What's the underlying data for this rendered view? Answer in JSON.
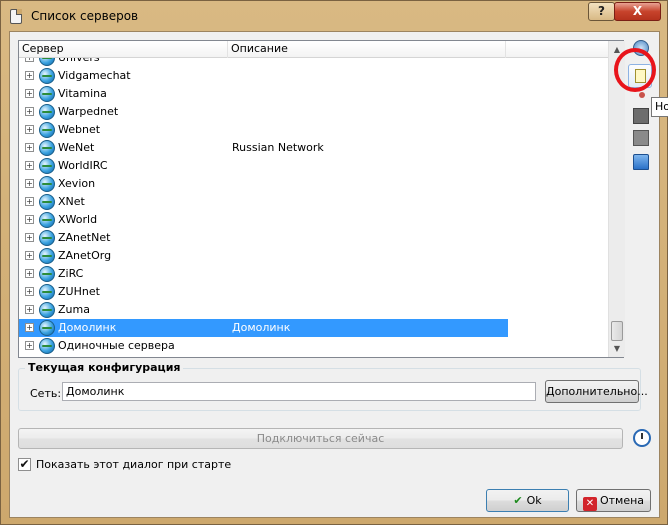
{
  "window": {
    "title": "Список серверов",
    "help_label": "?",
    "close_label": "X"
  },
  "list": {
    "columns": [
      "Сервер",
      "Описание"
    ],
    "rows": [
      {
        "name": "Univers",
        "desc": ""
      },
      {
        "name": "Vidgamechat",
        "desc": ""
      },
      {
        "name": "Vitamina",
        "desc": ""
      },
      {
        "name": "Warpednet",
        "desc": ""
      },
      {
        "name": "Webnet",
        "desc": ""
      },
      {
        "name": "WeNet",
        "desc": "Russian Network"
      },
      {
        "name": "WorldIRC",
        "desc": ""
      },
      {
        "name": "Xevion",
        "desc": ""
      },
      {
        "name": "XNet",
        "desc": ""
      },
      {
        "name": "XWorld",
        "desc": ""
      },
      {
        "name": "ZAnetNet",
        "desc": ""
      },
      {
        "name": "ZAnetOrg",
        "desc": ""
      },
      {
        "name": "ZiRC",
        "desc": ""
      },
      {
        "name": "ZUHnet",
        "desc": ""
      },
      {
        "name": "Zuma",
        "desc": ""
      },
      {
        "name": "Домолинк",
        "desc": "Домолинк",
        "selected": true
      },
      {
        "name": "Одиночные сервера",
        "desc": ""
      }
    ]
  },
  "toolbar": {
    "tooltip": "Но"
  },
  "config": {
    "group_title": "Текущая конфигурация",
    "net_label": "Сеть:",
    "net_value": "Домолинк",
    "advanced_label": "Дополнительно..."
  },
  "connect_label": "Подключиться сейчас",
  "show_on_start_label": "Показать этот диалог при старте",
  "show_on_start_checked": true,
  "ok_label": "Ok",
  "cancel_label": "Отмена"
}
